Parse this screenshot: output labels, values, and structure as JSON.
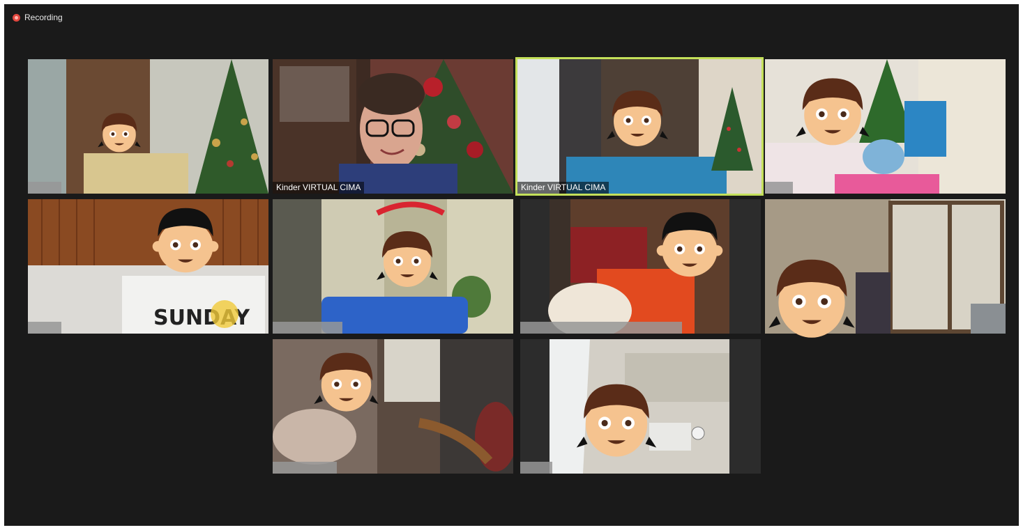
{
  "recording": {
    "label": "Recording",
    "color": "#e2473f"
  },
  "active_speaker_color": "#c4e05a",
  "tiles": [
    {
      "id": "tile-1",
      "name": ""
    },
    {
      "id": "tile-2",
      "name": "Kinder VIRTUAL CIMA"
    },
    {
      "id": "tile-3",
      "name": "Kinder VIRTUAL CIMA",
      "active_speaker": true
    },
    {
      "id": "tile-4",
      "name": ""
    },
    {
      "id": "tile-5",
      "name": ""
    },
    {
      "id": "tile-6",
      "name": ""
    },
    {
      "id": "tile-7",
      "name": ""
    },
    {
      "id": "tile-8",
      "name": ""
    },
    {
      "id": "tile-9",
      "name": ""
    },
    {
      "id": "tile-10",
      "name": ""
    }
  ],
  "icons": {
    "recording": "recording-dot-icon",
    "face_cover": "girl-emoji-icon",
    "face_cover_alt": "boy-emoji-icon"
  }
}
